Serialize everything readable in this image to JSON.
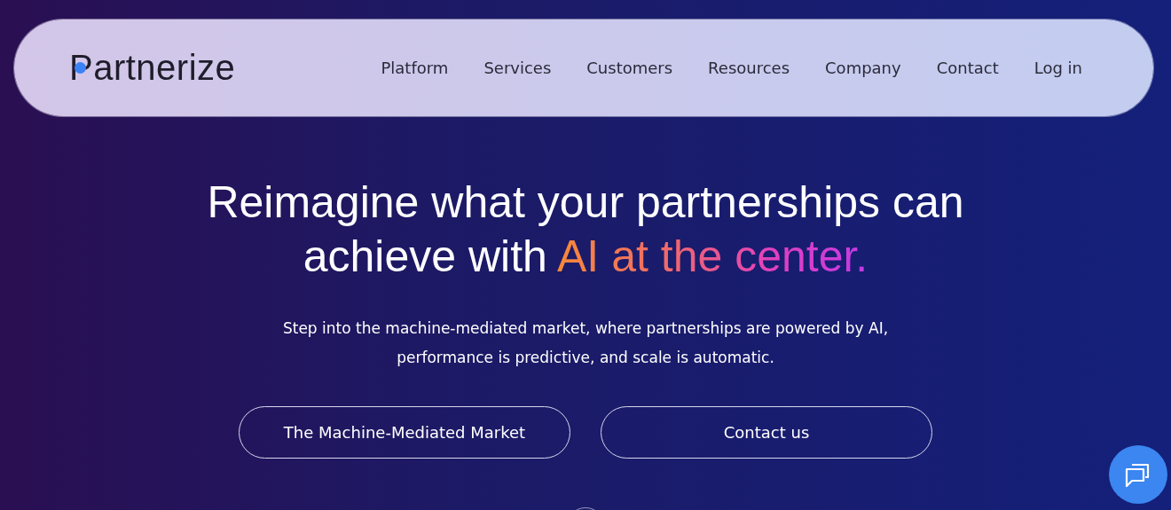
{
  "nav": {
    "logo": "Partnerize",
    "links": [
      {
        "label": "Platform"
      },
      {
        "label": "Services"
      },
      {
        "label": "Customers"
      },
      {
        "label": "Resources"
      },
      {
        "label": "Company"
      },
      {
        "label": "Contact"
      },
      {
        "label": "Log in"
      }
    ]
  },
  "hero": {
    "headline": "Reimagine what your partnerships can achieve with",
    "headline_highlight": "AI at the center.",
    "subtitle": "Step into the machine-mediated market, where partnerships are powered by AI, performance is predictive, and scale is automatic.",
    "buttons": [
      {
        "label": "The Machine-Mediated Market"
      },
      {
        "label": "Contact us"
      }
    ]
  }
}
